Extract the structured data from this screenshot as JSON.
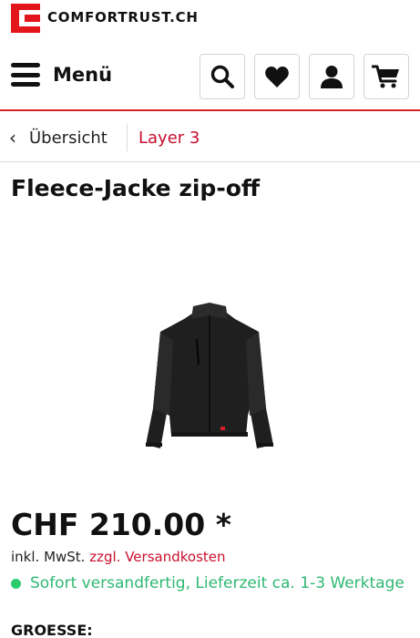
{
  "brand": {
    "name": "COMFORTRUST.CH",
    "color": "#e3161b"
  },
  "nav": {
    "menu_label": "Menü",
    "icons": [
      "search-icon",
      "heart-icon",
      "user-icon",
      "cart-icon"
    ]
  },
  "breadcrumb": {
    "back_label": "Übersicht",
    "current": "Layer 3"
  },
  "product": {
    "title": "Fleece-Jacke zip-off",
    "price": "CHF 210.00 *",
    "tax_prefix": "inkl. MwSt.",
    "shipping_link": "zzgl. Versandkosten",
    "availability": "Sofort versandfertig, Lieferzeit ca. 1-3 Werktage",
    "size_label": "GROESSE:"
  },
  "colors": {
    "accent": "#c8102e",
    "available": "#2eb872"
  }
}
